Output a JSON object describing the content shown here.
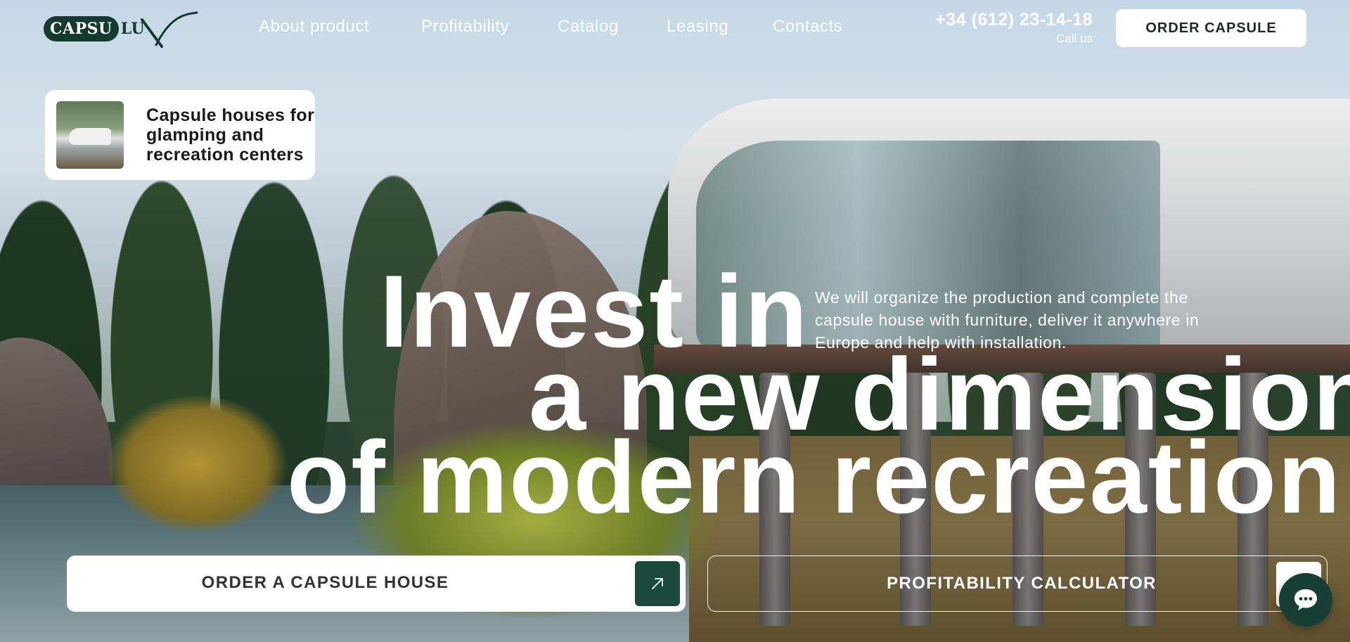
{
  "brand": {
    "logo_part1": "CAPSU",
    "logo_part2": "LU",
    "logo_color": "#143a2e"
  },
  "nav": {
    "items": [
      "About product",
      "Profitability",
      "Catalog",
      "Leasing",
      "Contacts"
    ]
  },
  "contact": {
    "phone": "+34 (612) 23-14-18",
    "caption": "Call us"
  },
  "header": {
    "order_button": "ORDER CAPSULE"
  },
  "promo": {
    "text": "Capsule houses for glamping and recreation centers"
  },
  "hero": {
    "line1": "Invest in",
    "line2": "a new dimension",
    "line3": "of modern recreation",
    "description": "We will organize the production and complete the capsule house with furniture, deliver it anywhere in Europe and help with installation."
  },
  "cta": {
    "order_label": "ORDER A CAPSULE HOUSE",
    "calculator_label": "PROFITABILITY CALCULATOR"
  },
  "icons": {
    "order_arrow": "arrow-up-right-icon",
    "chat": "chat-bubble-icon"
  },
  "colors": {
    "accent": "#1b4a3c",
    "chat": "#173f33",
    "text_light": "#ffffff"
  }
}
